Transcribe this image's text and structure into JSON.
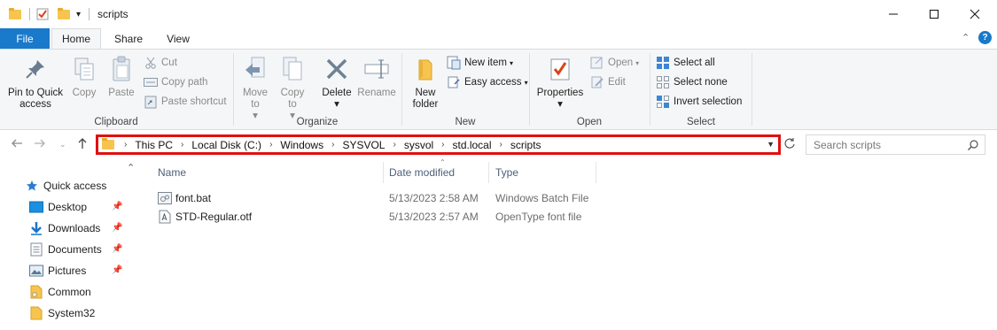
{
  "window": {
    "title": "scripts",
    "controls": {
      "minimize": "—",
      "maximize": "☐",
      "close": "✕"
    }
  },
  "ribbon_tabs": [
    {
      "label": "File"
    },
    {
      "label": "Home"
    },
    {
      "label": "Share"
    },
    {
      "label": "View"
    }
  ],
  "ribbon": {
    "clipboard": {
      "label": "Clipboard",
      "pin": "Pin to Quick access",
      "copy": "Copy",
      "paste": "Paste",
      "cut": "Cut",
      "copy_path": "Copy path",
      "paste_shortcut": "Paste shortcut"
    },
    "organize": {
      "label": "Organize",
      "move_to": "Move to",
      "copy_to": "Copy to",
      "delete": "Delete",
      "rename": "Rename"
    },
    "new": {
      "label": "New",
      "new_folder": "New folder",
      "new_item": "New item",
      "easy_access": "Easy access"
    },
    "open": {
      "label": "Open",
      "properties": "Properties",
      "open": "Open",
      "edit": "Edit"
    },
    "select": {
      "label": "Select",
      "select_all": "Select all",
      "select_none": "Select none",
      "invert_selection": "Invert selection"
    }
  },
  "address": {
    "crumbs": [
      "This PC",
      "Local Disk (C:)",
      "Windows",
      "SYSVOL",
      "sysvol",
      "std.local",
      "scripts"
    ],
    "search_placeholder": "Search scripts"
  },
  "nav": {
    "items": [
      {
        "label": "Quick access",
        "pinned": false
      },
      {
        "label": "Desktop",
        "pinned": true
      },
      {
        "label": "Downloads",
        "pinned": true
      },
      {
        "label": "Documents",
        "pinned": true
      },
      {
        "label": "Pictures",
        "pinned": true
      },
      {
        "label": "Common",
        "pinned": false
      },
      {
        "label": "System32",
        "pinned": false
      }
    ]
  },
  "files": {
    "columns": {
      "name": "Name",
      "date": "Date modified",
      "type": "Type"
    },
    "rows": [
      {
        "name": "font.bat",
        "date": "5/13/2023 2:58 AM",
        "type": "Windows Batch File",
        "icon": "batch-file-icon"
      },
      {
        "name": "STD-Regular.otf",
        "date": "5/13/2023 2:57 AM",
        "type": "OpenType font file",
        "icon": "font-file-icon"
      }
    ]
  },
  "colors": {
    "file_tab": "#1979ca",
    "highlight_border": "#e01010",
    "folder": "#f6c44f",
    "accent": "#0b5fb6"
  }
}
